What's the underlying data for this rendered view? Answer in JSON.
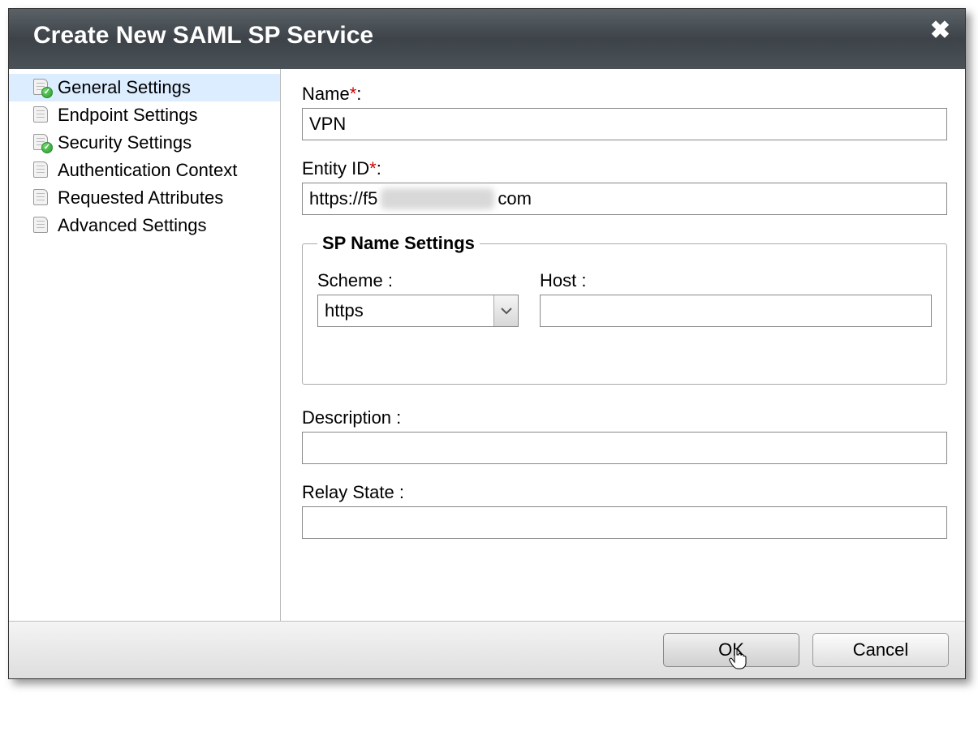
{
  "dialog": {
    "title": "Create New SAML SP Service"
  },
  "sidebar": {
    "items": [
      {
        "label": "General Settings",
        "checked": true,
        "selected": true
      },
      {
        "label": "Endpoint Settings",
        "checked": false,
        "selected": false
      },
      {
        "label": "Security Settings",
        "checked": true,
        "selected": false
      },
      {
        "label": "Authentication Context",
        "checked": false,
        "selected": false
      },
      {
        "label": "Requested Attributes",
        "checked": false,
        "selected": false
      },
      {
        "label": "Advanced Settings",
        "checked": false,
        "selected": false
      }
    ]
  },
  "form": {
    "name_label": "Name",
    "name_value": "VPN",
    "entity_id_label": "Entity ID",
    "entity_id_prefix": "https://f5",
    "entity_id_suffix": "com",
    "sp_name_settings_legend": "SP Name Settings",
    "scheme_label": "Scheme :",
    "scheme_value": "https",
    "host_label": "Host :",
    "host_value": "",
    "description_label": "Description :",
    "description_value": "",
    "relay_state_label": "Relay State :",
    "relay_state_value": ""
  },
  "footer": {
    "ok_label": "OK",
    "cancel_label": "Cancel"
  },
  "required_marker": "*"
}
